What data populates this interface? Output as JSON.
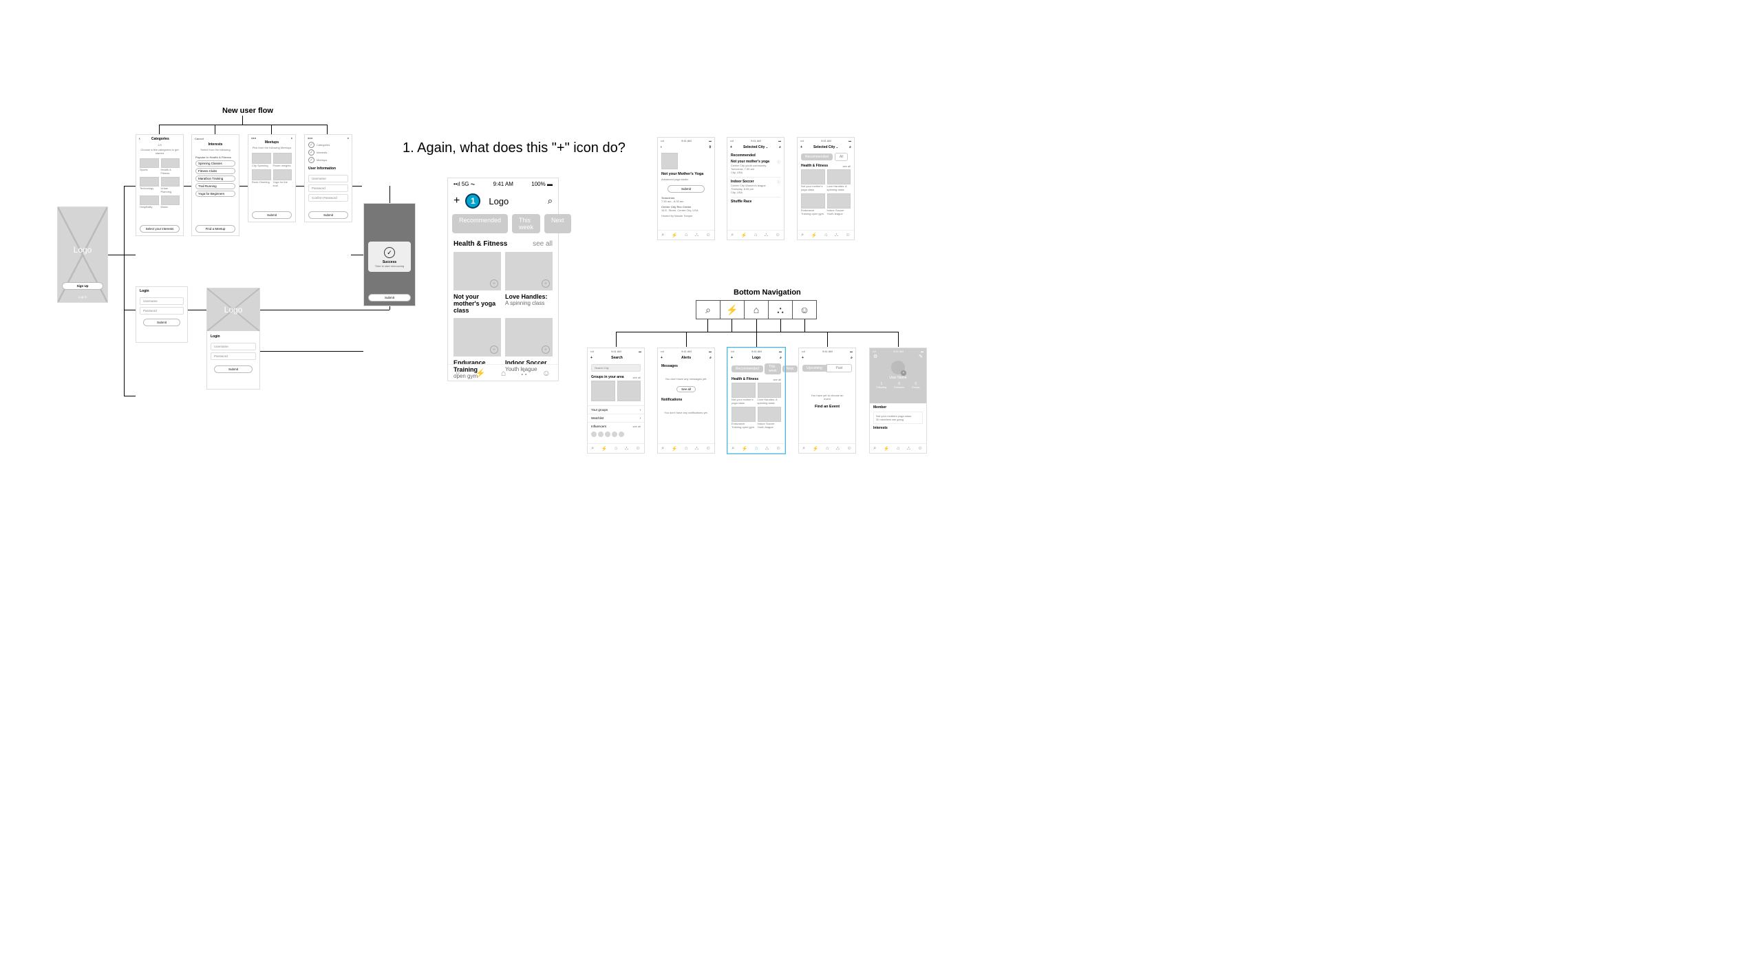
{
  "headings": {
    "new_user_flow": "New user flow",
    "bottom_navigation": "Bottom Navigation"
  },
  "annotation": {
    "number": "1",
    "text": "1. Again, what does this \"+\" icon do?"
  },
  "status": {
    "carrier": "5G",
    "time": "9:41 AM",
    "battery": "100%"
  },
  "splash": {
    "logo": "Logo",
    "signup": "Sign Up",
    "login": "Log in"
  },
  "login": {
    "title": "Login",
    "username_ph": "Username",
    "password_ph": "Password",
    "submit": "Submit"
  },
  "categories": {
    "title": "Categories",
    "subtitle_top": "1/3",
    "subtitle": "Choose a few categories to get started",
    "items": [
      "Sports",
      "Health & Fitness",
      "Technology",
      "Urban Planning",
      "Hospitality",
      "Music"
    ],
    "cta": "Select your interests"
  },
  "interests": {
    "back": "Cancel",
    "title": "Interests",
    "subtitle": "Select from the following",
    "section": "Popular in Health & Fitness",
    "chips": [
      "Spinning Classes",
      "Fitness Clubs",
      "Marathon Training",
      "Trail Running",
      "Yoga for Beginners"
    ],
    "cta": "Find a Meetup"
  },
  "meetups": {
    "title": "Meetups",
    "subtitle": "Pick from the following Meetups",
    "cards": [
      "City Spinning",
      "Power weights",
      "Rock Climbing",
      "Yoga for the soul"
    ],
    "cta": "Submit"
  },
  "userinfo": {
    "section": "User Information",
    "fields": [
      "Username",
      "Password",
      "Confirm Password"
    ],
    "list_items": [
      "Categories",
      "Interests",
      "Meetups"
    ],
    "cta": "Submit"
  },
  "success": {
    "title": "Success",
    "subtitle": "Time to start shmoozing",
    "cta": "Submit"
  },
  "feed": {
    "logo": "Logo",
    "chips": [
      "Recommended",
      "This week",
      "Next"
    ],
    "section": "Health & Fitness",
    "see_all": "see all",
    "cards": [
      {
        "title": "Not your mother's yoga class",
        "sub": ""
      },
      {
        "title": "Love Handles:",
        "sub": "A spinning class"
      },
      {
        "title": "Endurance Training",
        "sub": "open gym"
      },
      {
        "title": "Indoor Soccer",
        "sub": "Youth league"
      }
    ]
  },
  "event_detail": {
    "title": "Not your Mother's Yoga",
    "subtitle": "Advanced yoga studio",
    "submit": "Submit",
    "when_lead": "Tomorrow",
    "when": "7:30 am - 8:30 am",
    "where_title": "Center City Rec Center",
    "where_addr": "16 E. Street, Center City, USA",
    "host": "Hosted by Maude Tamper"
  },
  "city_feed": {
    "title": "Selected City",
    "recommended": "Recommended",
    "events": [
      {
        "name": "Not your mother's yoga",
        "line2": "Center City youth community",
        "line3": "Tomorrow, 7:30 am",
        "line4": "City, USA"
      },
      {
        "name": "Indoor Soccer",
        "line2": "Center City Women's league",
        "line3": "Thursday, 8:45 pm",
        "line4": "City, USA"
      },
      {
        "name": "Shuffle Race",
        "line2": "",
        "line3": "",
        "line4": ""
      }
    ]
  },
  "city_grid": {
    "title": "Selected City",
    "section": "Health & Fitness",
    "see_all": "see all",
    "cards": [
      {
        "title": "Not your mother's yoga class"
      },
      {
        "title": "Love Handles: A spinning class"
      },
      {
        "title": "Endurance Training open gym"
      },
      {
        "title": "Indoor Soccer Youth league"
      }
    ],
    "tab_recommended": "Recommended",
    "tab_all": "All"
  },
  "search": {
    "title": "Search",
    "placeholder": "Search City",
    "sections": {
      "groups": "Groups in your area",
      "your_groups": "Your groups",
      "watchlist": "Watchlist",
      "influencers": "Influencers",
      "see_all": "see all"
    }
  },
  "alerts": {
    "title": "Alerts",
    "messages": "Messages",
    "msg_empty": "You don't have any messages yet.",
    "see_all": "See all",
    "notifications": "Notifications",
    "notif_empty": "You don't have any notifications yet."
  },
  "home_small": {
    "logo": "Logo",
    "section": "Health & Fitness",
    "see_all": "see all",
    "cards": [
      {
        "title": "Not your mother's yoga class"
      },
      {
        "title": "Love Handles: A spinning class"
      },
      {
        "title": "Endurance Training open gym"
      },
      {
        "title": "Indoor Soccer Youth league"
      }
    ],
    "tabs": [
      "Recommended",
      "This week",
      "Next"
    ]
  },
  "events": {
    "tabs": [
      "Upcoming",
      "Past"
    ],
    "empty": "You have yet to choose an event",
    "cta": "Find an Event"
  },
  "profile": {
    "name": "User Name",
    "stats_labels": [
      "Following",
      "Followers",
      "Groups"
    ],
    "stats_values": [
      "1",
      "0",
      "0"
    ],
    "member": "Member",
    "member_line": "Not your mothers yoga class:",
    "member_count": "30 members are going",
    "interests": "Interests"
  },
  "nav_icons": [
    "search",
    "bolt",
    "home",
    "group",
    "user"
  ]
}
